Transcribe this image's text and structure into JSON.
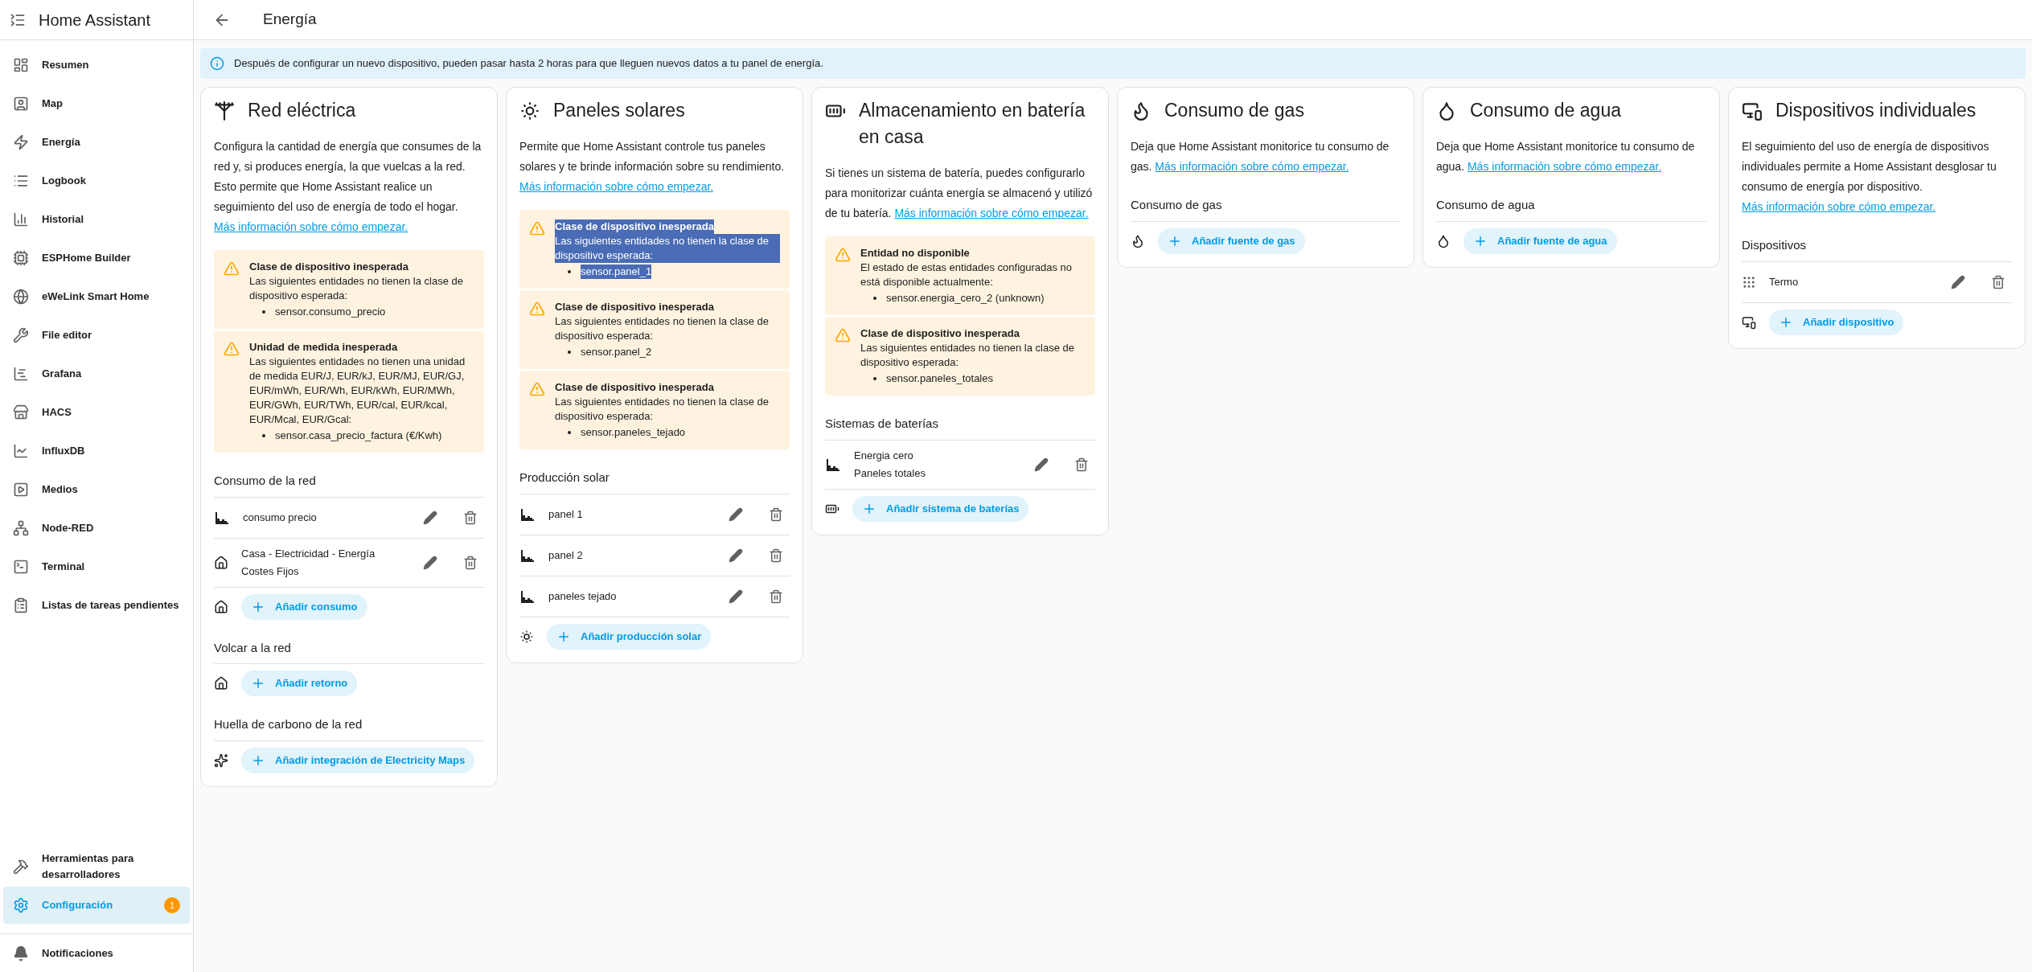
{
  "sidebar": {
    "title": "Home Assistant",
    "items": [
      {
        "label": "Resumen",
        "selected": false
      },
      {
        "label": "Map",
        "selected": false
      },
      {
        "label": "Energía",
        "selected": false
      },
      {
        "label": "Logbook",
        "selected": false
      },
      {
        "label": "Historial",
        "selected": false
      },
      {
        "label": "ESPHome Builder",
        "selected": false
      },
      {
        "label": "eWeLink Smart Home",
        "selected": false
      },
      {
        "label": "File editor",
        "selected": false
      },
      {
        "label": "Grafana",
        "selected": false
      },
      {
        "label": "HACS",
        "selected": false
      },
      {
        "label": "InfluxDB",
        "selected": false
      },
      {
        "label": "Medios",
        "selected": false
      },
      {
        "label": "Node-RED",
        "selected": false
      },
      {
        "label": "Terminal",
        "selected": false
      },
      {
        "label": "Listas de tareas pendientes",
        "selected": false
      }
    ],
    "bottom_items": [
      {
        "label": "Herramientas para desarrolladores",
        "selected": false
      },
      {
        "label": "Configuración",
        "selected": true,
        "badge": "1"
      }
    ],
    "notifications": "Notificaciones"
  },
  "header": {
    "title": "Energía"
  },
  "banner": "Después de configurar un nuevo dispositivo, pueden pasar hasta 2 horas para que lleguen nuevos datos a tu panel de energía.",
  "cards": [
    {
      "title": "Red eléctrica",
      "description": "Configura la cantidad de energía que consumes de la red y, si produces energía, la que vuelcas a la red. Esto permite que Home Assistant realice un seguimiento del uso de energía de todo el hogar.",
      "link": "Más información sobre cómo empezar.",
      "warnings": [
        {
          "title": "Clase de dispositivo inesperada",
          "text": "Las siguientes entidades no tienen la clase de dispositivo esperada:",
          "entities": [
            "sensor.consumo_precio"
          ],
          "highlighted": false
        },
        {
          "title": "Unidad de medida inesperada",
          "text": "Las siguientes entidades no tienen una unidad de medida EUR/J, EUR/kJ, EUR/MJ, EUR/GJ, EUR/mWh, EUR/Wh, EUR/kWh, EUR/MWh, EUR/GWh, EUR/TWh, EUR/cal, EUR/kcal, EUR/Mcal, EUR/Gcal:",
          "entities": [
            "sensor.casa_precio_factura (€/Kwh)"
          ],
          "highlighted": false
        }
      ],
      "sections": [
        {
          "heading": "Consumo de la red",
          "rows": [
            {
              "kind": "chart",
              "lines": [
                "consumo precio"
              ]
            },
            {
              "kind": "house",
              "lines": [
                "Casa - Electricidad - Energía Costes Fijos"
              ]
            }
          ],
          "add": "Añadir consumo"
        },
        {
          "heading": "Volcar a la red",
          "add": "Añadir retorno"
        },
        {
          "heading": "Huella de carbono de la red",
          "add": "Añadir integración de Electricity Maps"
        }
      ]
    },
    {
      "title": "Paneles solares",
      "description": "Permite que Home Assistant controle tus paneles solares y te brinde información sobre su rendimiento.",
      "link": "Más información sobre cómo empezar.",
      "warnings": [
        {
          "title": "Clase de dispositivo inesperada",
          "text": "Las siguientes entidades no tienen la clase de dispositivo esperada:",
          "entities": [
            "sensor.panel_1"
          ],
          "highlighted": true
        },
        {
          "title": "Clase de dispositivo inesperada",
          "text": "Las siguientes entidades no tienen la clase de dispositivo esperada:",
          "entities": [
            "sensor.panel_2"
          ],
          "highlighted": false
        },
        {
          "title": "Clase de dispositivo inesperada",
          "text": "Las siguientes entidades no tienen la clase de dispositivo esperada:",
          "entities": [
            "sensor.paneles_tejado"
          ],
          "highlighted": false
        }
      ],
      "sections": [
        {
          "heading": "Producción solar",
          "rows": [
            {
              "kind": "chart",
              "lines": [
                "panel 1"
              ]
            },
            {
              "kind": "chart",
              "lines": [
                "panel 2"
              ]
            },
            {
              "kind": "chart",
              "lines": [
                "paneles tejado"
              ]
            }
          ],
          "add": "Añadir producción solar"
        }
      ]
    },
    {
      "title": "Almacenamiento en batería en casa",
      "description": "Si tienes un sistema de batería, puedes configurarlo para monitorizar cuánta energía se almacenó y utilizó de tu batería.",
      "link": "Más información sobre cómo empezar.",
      "warnings": [
        {
          "title": "Entidad no disponible",
          "text": "El estado de estas entidades configuradas no está disponible actualmente:",
          "entities": [
            "sensor.energia_cero_2 (unknown)"
          ],
          "highlighted": false
        },
        {
          "title": "Clase de dispositivo inesperada",
          "text": "Las siguientes entidades no tienen la clase de dispositivo esperada:",
          "entities": [
            "sensor.paneles_totales"
          ],
          "highlighted": false
        }
      ],
      "sections": [
        {
          "heading": "Sistemas de baterías",
          "rows": [
            {
              "kind": "chart",
              "lines": [
                "Energia cero",
                "Paneles totales"
              ]
            }
          ],
          "add": "Añadir sistema de baterías"
        }
      ]
    },
    {
      "title": "Consumo de gas",
      "description": "Deja que Home Assistant monitorice tu consumo de gas.",
      "link": "Más información sobre cómo empezar.",
      "sections": [
        {
          "heading": "Consumo de gas",
          "add": "Añadir fuente de gas"
        }
      ]
    },
    {
      "title": "Consumo de agua",
      "description": "Deja que Home Assistant monitorice tu consumo de agua.",
      "link": "Más información sobre cómo empezar.",
      "sections": [
        {
          "heading": "Consumo de agua",
          "add": "Añadir fuente de agua"
        }
      ]
    },
    {
      "title": "Dispositivos individuales",
      "description": "El seguimiento del uso de energía de dispositivos individuales permite a Home Assistant desglosar tu consumo de energía por dispositivo.",
      "link": "Más información sobre cómo empezar.",
      "sections": [
        {
          "heading": "Dispositivos",
          "rows": [
            {
              "kind": "device",
              "lines": [
                "Termo"
              ]
            }
          ],
          "add": "Añadir dispositivo"
        }
      ]
    }
  ]
}
